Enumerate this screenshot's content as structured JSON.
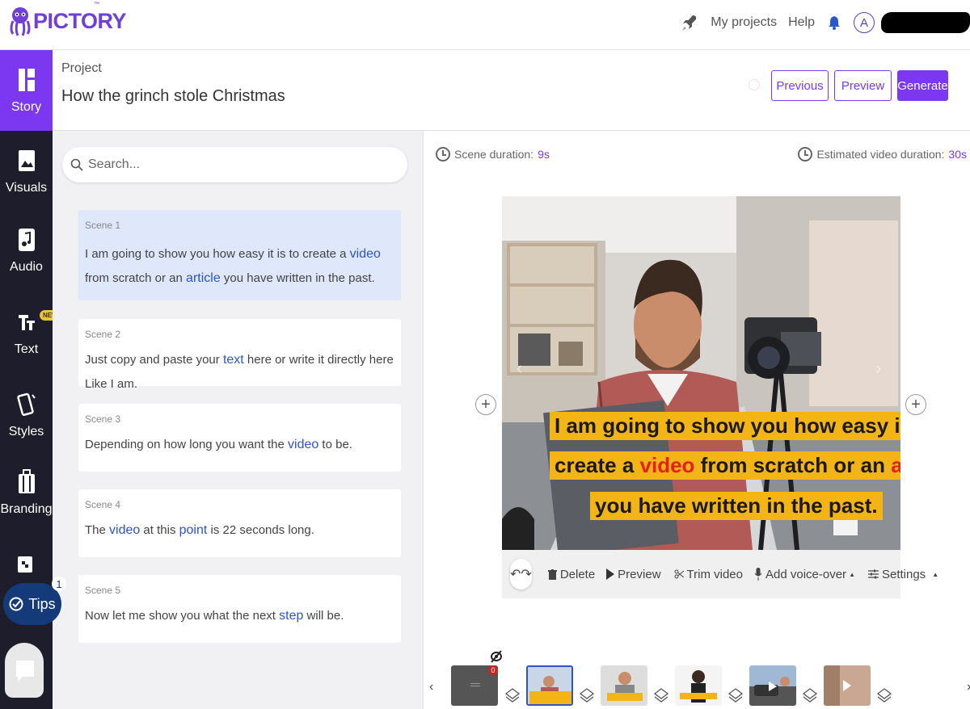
{
  "brand": {
    "name": "PICTORY",
    "tm": "™"
  },
  "top_nav": {
    "my_projects": "My projects",
    "help": "Help",
    "avatar_initial": "A"
  },
  "sidebar": {
    "items": [
      {
        "label": "Story",
        "icon": "story-icon",
        "active": true
      },
      {
        "label": "Visuals",
        "icon": "image-icon"
      },
      {
        "label": "Audio",
        "icon": "music-icon"
      },
      {
        "label": "Text",
        "icon": "text-icon",
        "badge": "NEW"
      },
      {
        "label": "Styles",
        "icon": "styles-icon"
      },
      {
        "label": "Branding",
        "icon": "branding-icon"
      }
    ],
    "tips_label": "Tips",
    "tips_count": "1"
  },
  "project": {
    "label": "Project",
    "title": "How the grinch stole Christmas",
    "buttons": {
      "previous": "Previous",
      "preview": "Preview",
      "generate": "Generate"
    }
  },
  "search": {
    "placeholder": "Search..."
  },
  "scenes": [
    {
      "number": "Scene 1",
      "parts": [
        "I am going to show you how easy it is to create a ",
        "video",
        " from scratch or an ",
        "article",
        " you have written in the past."
      ]
    },
    {
      "number": "Scene 2",
      "parts": [
        "Just copy and paste your ",
        "text",
        " here or write it directly here Like I am."
      ]
    },
    {
      "number": "Scene 3",
      "parts": [
        "Depending on how long you want the ",
        "video",
        " to be."
      ]
    },
    {
      "number": "Scene 4",
      "parts": [
        "The ",
        "video",
        " at this ",
        "point",
        " is 22 seconds long."
      ]
    },
    {
      "number": "Scene 5",
      "parts": [
        "Now let me show you what the next ",
        "step",
        " will be."
      ]
    }
  ],
  "editor": {
    "scene_duration_label": "Scene duration:",
    "scene_duration_value": "9s",
    "estimated_label": "Estimated video duration:",
    "estimated_value": "30s",
    "caption": {
      "line1": "I am going to show you how easy it is to",
      "line2_a": "create a ",
      "line2_b": "video",
      "line2_c": " from scratch or an ",
      "line2_d": "article",
      "line3": "you have written in the past."
    },
    "toolbar": {
      "undo": "↶",
      "redo": "↷",
      "delete": "Delete",
      "preview": "Preview",
      "trim": "Trim video",
      "voice": "Add voice-over",
      "settings": "Settings"
    }
  },
  "timeline": {
    "prev": "‹",
    "next": "›",
    "muted_badge": "0"
  },
  "colors": {
    "accent": "#7b38f0",
    "sidebar_bg": "#1d1d2b",
    "keyword": "#2d55c9",
    "caption_bg": "#f3b416",
    "caption_highlight": "#e42020"
  }
}
